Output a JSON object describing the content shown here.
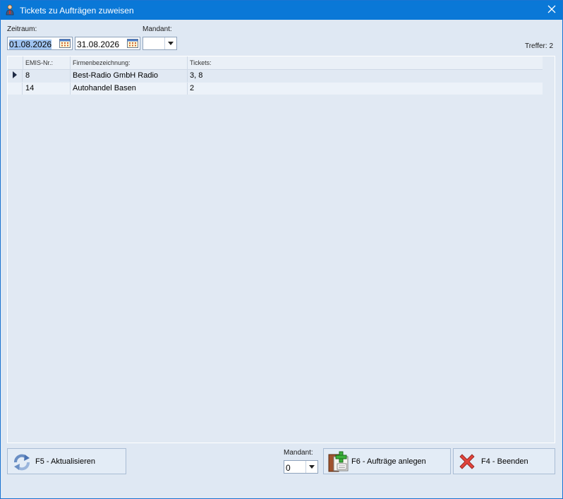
{
  "window": {
    "title": "Tickets zu Aufträgen zuweisen"
  },
  "filter": {
    "zeitraum_label": "Zeitraum:",
    "date_from": "01.08.2026",
    "date_to": "31.08.2026",
    "mandant_label": "Mandant:",
    "mandant_value": "",
    "treffer": "Treffer: 2"
  },
  "grid": {
    "columns": [
      "EMIS-Nr.:",
      "Firmenbezeichnung:",
      "Tickets:"
    ],
    "rows": [
      {
        "emis": "8",
        "firma": "Best-Radio GmbH Radio",
        "tickets": "3, 8"
      },
      {
        "emis": "14",
        "firma": "Autohandel Basen",
        "tickets": "2"
      }
    ]
  },
  "footer": {
    "refresh_label": "F5 - Aktualisieren",
    "mandant_label": "Mandant:",
    "mandant_value": "0",
    "create_label": "F6 - Aufträge anlegen",
    "close_label": "F4 - Beenden"
  },
  "colors": {
    "titlebar": "#0a78d7",
    "window_bg": "#dfe8f3",
    "selection": "#9fc3f0"
  },
  "icons": {
    "title": "user-icon",
    "close": "close-icon",
    "calendar": "calendar-icon",
    "refresh": "refresh-icon",
    "create": "add-document-icon",
    "cancel": "red-x-icon"
  }
}
